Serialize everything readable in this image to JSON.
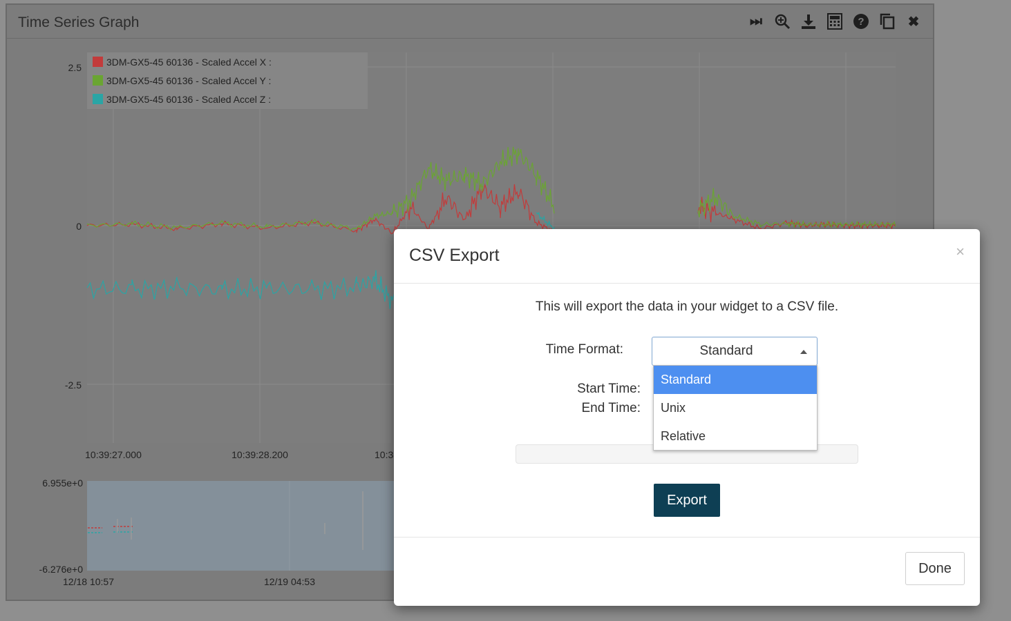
{
  "widget": {
    "title": "Time Series Graph",
    "toolbar_icons": [
      "skip-to-end-icon",
      "zoom-in-icon",
      "download-icon",
      "calculator-icon",
      "help-icon",
      "copy-icon",
      "close-icon"
    ]
  },
  "chart_data": [
    {
      "type": "line",
      "title": "",
      "xlabel": "",
      "ylabel": "",
      "y_ticks": [
        "2.5",
        "0",
        "-2.5"
      ],
      "y_tick_values": [
        2.5,
        0,
        -2.5
      ],
      "ylim": [
        -3.4,
        2.7
      ],
      "x_ticks": [
        "10:39:27.000",
        "10:39:28.200",
        "10:3"
      ],
      "grid": true,
      "legend_position": "top-left",
      "series": [
        {
          "name": "3DM-GX5-45 60136 - Scaled Accel X :",
          "color": "#c23b3b",
          "x": [
            0,
            0.5,
            1,
            1.5,
            2,
            2.5,
            3,
            3.2,
            3.4,
            3.6,
            3.8,
            4.0,
            4.2,
            4.4,
            4.6,
            4.8,
            5.0,
            5.2,
            5.4,
            5.6,
            5.8,
            6.0,
            6.2,
            6.4,
            6.6,
            6.8,
            7.0,
            7.2,
            7.5,
            7.8,
            8.0,
            8.2,
            8.4,
            8.6,
            8.8,
            9.0
          ],
          "values": [
            0,
            0.02,
            -0.05,
            0.03,
            -0.04,
            0.05,
            -0.08,
            0.1,
            -0.12,
            0.3,
            -0.05,
            0.45,
            0.1,
            0.6,
            0.3,
            0.55,
            0.05,
            -0.1,
            null,
            null,
            null,
            null,
            null,
            null,
            null,
            0.3,
            0.2,
            0.1,
            -0.05,
            0.05,
            0,
            0.02,
            0,
            0,
            0,
            0
          ]
        },
        {
          "name": "3DM-GX5-45 60136 - Scaled Accel Y :",
          "color": "#6aa532",
          "x": [
            0,
            0.5,
            1,
            1.5,
            2,
            2.5,
            3,
            3.2,
            3.4,
            3.6,
            3.8,
            4.0,
            4.2,
            4.4,
            4.6,
            4.8,
            5.0,
            5.2,
            5.4,
            5.6,
            5.8,
            6.0,
            6.2,
            6.4,
            6.6,
            6.8,
            7.0,
            7.2,
            7.5,
            7.8,
            8.0,
            8.2,
            8.4,
            8.6,
            8.8,
            9.0
          ],
          "values": [
            0,
            0.03,
            -0.03,
            0.04,
            -0.02,
            0.06,
            -0.05,
            0.15,
            0.2,
            0.4,
            0.9,
            0.7,
            0.8,
            0.65,
            1.0,
            1.15,
            0.8,
            0.3,
            null,
            null,
            null,
            null,
            null,
            null,
            null,
            0.25,
            0.45,
            0.15,
            0.02,
            0.03,
            0.02,
            0.02,
            0.02,
            0.02,
            0.02,
            0.02
          ]
        },
        {
          "name": "3DM-GX5-45 60136 - Scaled Accel Z :",
          "color": "#2aa5a5",
          "x": [
            0,
            0.5,
            1,
            1.5,
            2,
            2.5,
            3,
            3.2,
            3.4,
            3.6,
            3.8,
            4.0,
            4.2,
            4.4,
            4.6,
            4.8,
            5.0,
            5.2
          ],
          "values": [
            -1.0,
            -1.0,
            -0.98,
            -1.01,
            -0.99,
            -1.0,
            -0.97,
            -0.85,
            -1.2,
            -0.9,
            -0.8,
            null,
            null,
            null,
            null,
            null,
            0.2,
            -0.05
          ]
        }
      ]
    },
    {
      "type": "area",
      "title": "",
      "y_ticks": [
        "6.955e+0",
        "-6.276e+0"
      ],
      "x_ticks": [
        "12/18 10:57",
        "12/19 04:53"
      ]
    }
  ],
  "modal": {
    "title": "CSV Export",
    "close_symbol": "×",
    "description": "This will export the data in your widget to a CSV file.",
    "time_format_label": "Time Format:",
    "time_format_value": "Standard",
    "time_format_options": [
      "Standard",
      "Unix",
      "Relative"
    ],
    "selected_option": "Standard",
    "start_time_label": "Start Time:",
    "end_time_label": "End Time:",
    "progress": 0,
    "export_label": "Export",
    "done_label": "Done"
  }
}
